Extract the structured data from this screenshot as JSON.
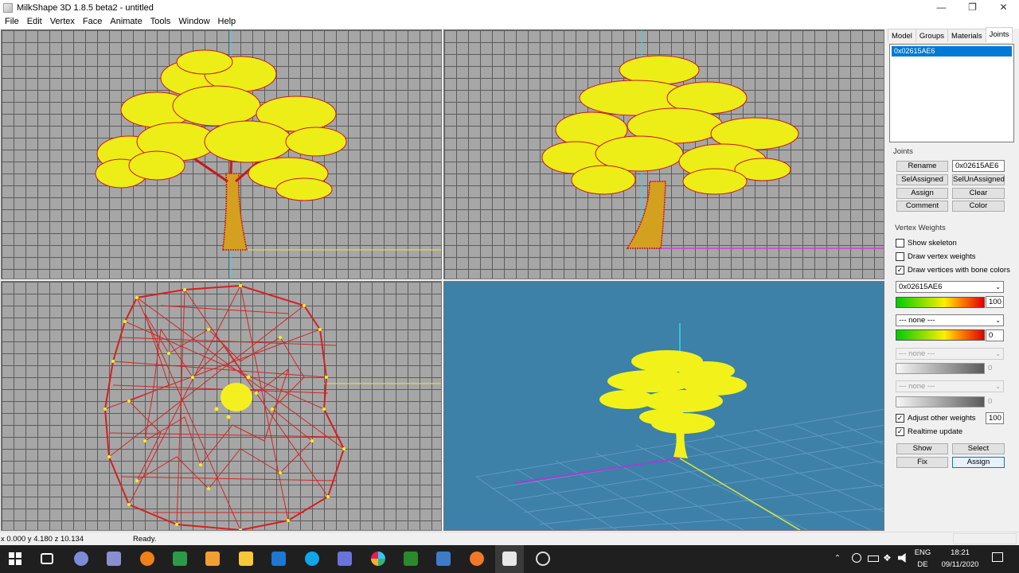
{
  "window": {
    "title": "MilkShape 3D 1.8.5 beta2 - untitled",
    "minimize": "—",
    "maximize": "❐",
    "close": "✕"
  },
  "menu": [
    "File",
    "Edit",
    "Vertex",
    "Face",
    "Animate",
    "Tools",
    "Window",
    "Help"
  ],
  "tabs": [
    "Model",
    "Groups",
    "Materials",
    "Joints"
  ],
  "active_tab": "Joints",
  "joints_list": [
    "0x02615AE6"
  ],
  "joints": {
    "label": "Joints",
    "rename": "Rename",
    "name_value": "0x02615AE6",
    "sel_assigned": "SelAssigned",
    "sel_unassigned": "SelUnAssigned",
    "assign": "Assign",
    "clear": "Clear",
    "comment": "Comment",
    "color": "Color"
  },
  "vertex_weights": {
    "label": "Vertex Weights",
    "show_skeleton": {
      "label": "Show skeleton",
      "checked": false
    },
    "draw_vertex_weights": {
      "label": "Draw vertex weights",
      "checked": false
    },
    "draw_vertices_bone_colors": {
      "label": "Draw vertices with bone colors",
      "checked": true
    },
    "bone1": {
      "value": "0x02615AE6",
      "weight": "100"
    },
    "bone2": {
      "value": "--- none ---",
      "weight": "0"
    },
    "bone3": {
      "value": "--- none ---",
      "weight": "0"
    },
    "bone4": {
      "value": "--- none ---",
      "weight": "0"
    },
    "adjust_other_weights": {
      "label": "Adjust other weights",
      "checked": true,
      "value": "100"
    },
    "realtime_update": {
      "label": "Realtime update",
      "checked": true
    },
    "show": "Show",
    "select": "Select",
    "fix": "Fix",
    "assign": "Assign"
  },
  "status": {
    "coords": "x 0.000 y 4.180 z 10.134",
    "message": "Ready."
  },
  "taskbar": {
    "lang": "ENG",
    "locale": "DE",
    "time": "18:21",
    "date": "09/11/2020"
  },
  "colors": {
    "mesh": "#f2f21a",
    "wire": "#d42020",
    "grid3d": "#3d80a8"
  }
}
